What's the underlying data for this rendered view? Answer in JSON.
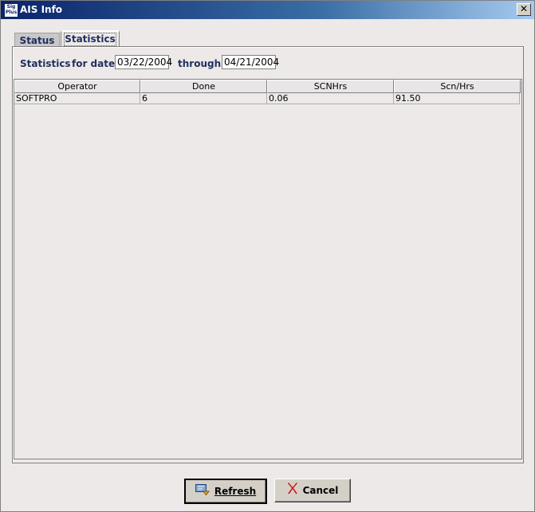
{
  "window": {
    "title": "AIS Info",
    "icon_text": "Sig Plus",
    "close_glyph": "✕"
  },
  "tabs": [
    {
      "label": "Status",
      "selected": false
    },
    {
      "label": "Statistics",
      "selected": true
    }
  ],
  "filter": {
    "statistics_label": "Statistics",
    "for_date_label": "for date",
    "from_date": "03/22/2004",
    "through_label": "through",
    "to_date": "04/21/2004"
  },
  "table": {
    "columns": [
      "Operator",
      "Done",
      "SCNHrs",
      "Scn/Hrs"
    ],
    "rows": [
      [
        "SOFTPRO",
        "6",
        "0.06",
        "91.50"
      ]
    ]
  },
  "buttons": {
    "refresh": {
      "label": "Refresh",
      "icon": "refresh-icon"
    },
    "cancel": {
      "label": "Cancel",
      "icon": "red-x-icon"
    }
  },
  "colors": {
    "title_gradient_start": "#0a246a",
    "label_text": "#1f2f5f",
    "cancel_icon": "#d01010"
  }
}
